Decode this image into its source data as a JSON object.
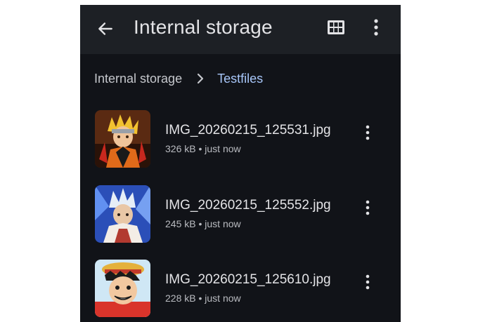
{
  "app_bar": {
    "title": "Internal storage",
    "back_icon": "arrow-back-icon",
    "grid_icon": "grid-view-icon",
    "more_icon": "more-vert-icon"
  },
  "breadcrumb": {
    "root": "Internal storage",
    "current": "Testfiles",
    "accent_color": "#a8c7fa"
  },
  "files": [
    {
      "name": "IMG_20260215_125531.jpg",
      "size": "326 kB",
      "time": "just now",
      "meta": "326 kB • just now"
    },
    {
      "name": "IMG_20260215_125552.jpg",
      "size": "245 kB",
      "time": "just now",
      "meta": "245 kB • just now"
    },
    {
      "name": "IMG_20260215_125610.jpg",
      "size": "228 kB",
      "time": "just now",
      "meta": "228 kB • just now"
    }
  ],
  "colors": {
    "background": "#111318",
    "app_bar": "#1d2025",
    "text_primary": "#e3e3e6",
    "text_secondary": "#b9bbc0"
  }
}
